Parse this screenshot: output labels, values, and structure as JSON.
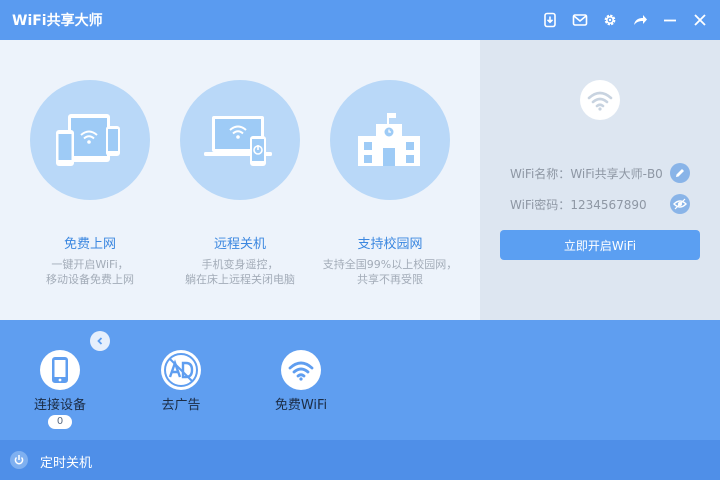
{
  "app": {
    "title": "WiFi共享大师"
  },
  "titlebar": {
    "buttons": [
      "download-icon",
      "mail-icon",
      "gear-icon",
      "share-icon",
      "minimize-icon",
      "close-icon"
    ]
  },
  "features": [
    {
      "icon": "devices-icon",
      "title": "免费上网",
      "desc1": "一键开启WiFi，",
      "desc2": "移动设备免费上网"
    },
    {
      "icon": "remote-shutdown-icon",
      "title": "远程关机",
      "desc1": "手机变身遥控，",
      "desc2": "躺在床上远程关闭电脑"
    },
    {
      "icon": "campus-icon",
      "title": "支持校园网",
      "desc1": "支持全国99%以上校园网，",
      "desc2": "共享不再受限"
    }
  ],
  "wifi_info": {
    "name_label": "WiFi名称：",
    "name_value": "WiFi共享大师-B0",
    "password_label": "WiFi密码：",
    "password_value": "1234567890",
    "open_button": "立即开启WiFi"
  },
  "tools": [
    {
      "icon": "phone-icon",
      "label": "连接设备",
      "badge": "0"
    },
    {
      "icon": "no-ad-icon",
      "label": "去广告"
    },
    {
      "icon": "wifi-icon",
      "label": "免费WiFi"
    }
  ],
  "footer": {
    "label": "定时关机"
  },
  "colors": {
    "titlebar": "#5a9bf0",
    "accent": "#3b87e0",
    "bottom_panel": "#5f9ef0",
    "footer": "#4f8fe8"
  }
}
